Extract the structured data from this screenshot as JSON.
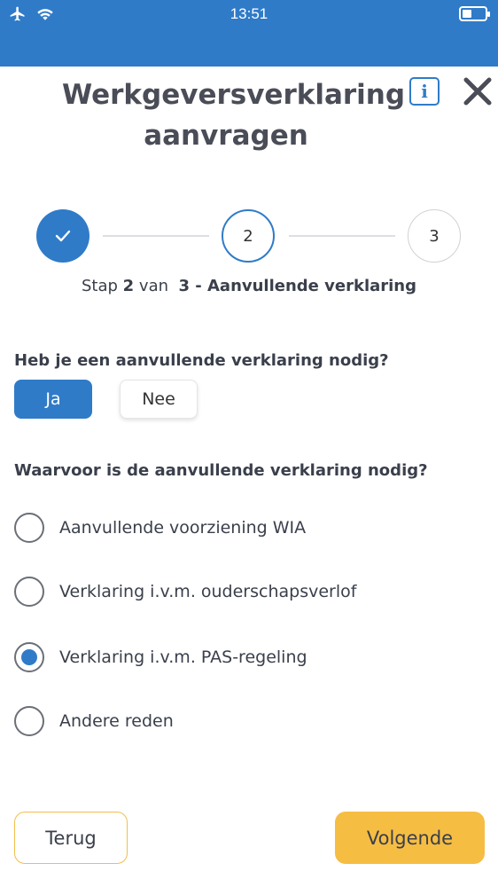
{
  "status_bar": {
    "time": "13:51"
  },
  "header": {
    "title_line1": "Werkgeversverklaring",
    "title_line2": "aanvragen",
    "info_label": "i"
  },
  "stepper": {
    "steps": [
      {
        "label": "✓",
        "state": "done"
      },
      {
        "label": "2",
        "state": "current"
      },
      {
        "label": "3",
        "state": "todo"
      }
    ],
    "caption": {
      "prefix": "Stap",
      "current": "2",
      "of": "van",
      "total_and_name": "3 - Aanvullende verklaring"
    }
  },
  "question1": {
    "text": "Heb je een aanvullende verklaring nodig?",
    "yes_label": "Ja",
    "no_label": "Nee",
    "selected": "Ja"
  },
  "question2": {
    "text": "Waarvoor is de aanvullende verklaring nodig?",
    "options": [
      {
        "label": "Aanvullende voorziening WIA",
        "checked": false
      },
      {
        "label": "Verklaring i.v.m. ouderschapsverlof",
        "checked": false
      },
      {
        "label": "Verklaring i.v.m. PAS-regeling",
        "checked": true
      },
      {
        "label": "Andere reden",
        "checked": false
      }
    ]
  },
  "footer": {
    "back_label": "Terug",
    "next_label": "Volgende"
  },
  "colors": {
    "primary": "#2f7bc8",
    "accent": "#f6bd43"
  }
}
